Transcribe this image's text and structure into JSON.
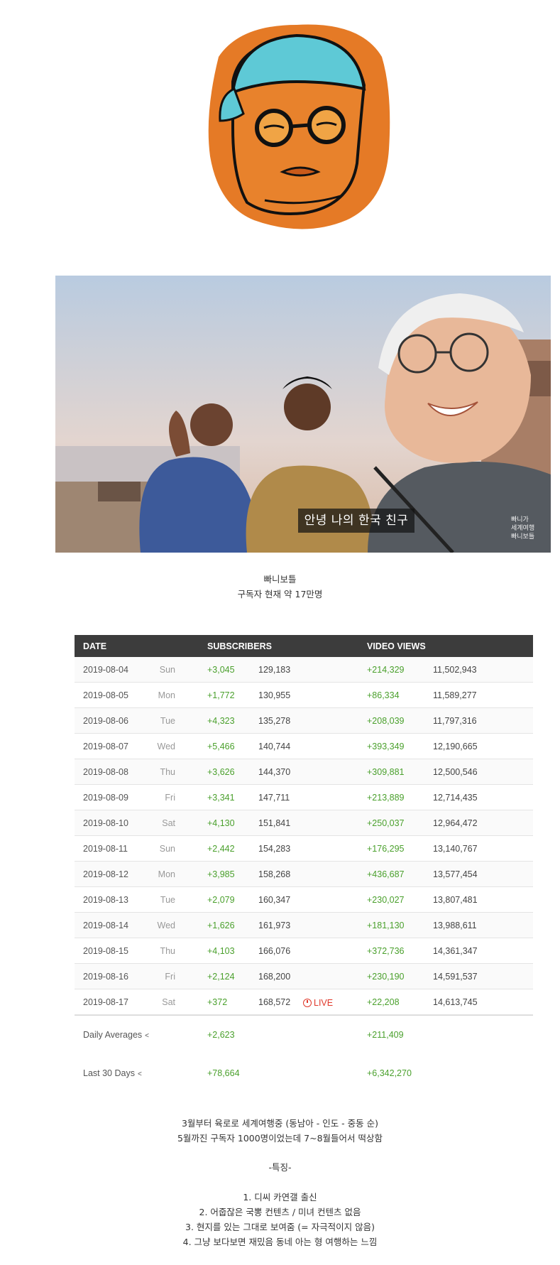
{
  "caption1": [
    "빠니보틀",
    "구독자 현재 약 17만명"
  ],
  "photo": {
    "subtitle": "안녕 나의 한국 친구",
    "watermark": [
      "빠니가",
      "세계여행",
      "빠니보틀"
    ]
  },
  "stats": {
    "headers": {
      "date": "DATE",
      "subscribers": "SUBSCRIBERS",
      "views": "VIDEO VIEWS"
    },
    "rows": [
      {
        "date": "2019-08-04",
        "day": "Sun",
        "sub_delta": "+3,045",
        "sub_total": "129,183",
        "view_delta": "+214,329",
        "view_total": "11,502,943",
        "live": ""
      },
      {
        "date": "2019-08-05",
        "day": "Mon",
        "sub_delta": "+1,772",
        "sub_total": "130,955",
        "view_delta": "+86,334",
        "view_total": "11,589,277",
        "live": ""
      },
      {
        "date": "2019-08-06",
        "day": "Tue",
        "sub_delta": "+4,323",
        "sub_total": "135,278",
        "view_delta": "+208,039",
        "view_total": "11,797,316",
        "live": ""
      },
      {
        "date": "2019-08-07",
        "day": "Wed",
        "sub_delta": "+5,466",
        "sub_total": "140,744",
        "view_delta": "+393,349",
        "view_total": "12,190,665",
        "live": ""
      },
      {
        "date": "2019-08-08",
        "day": "Thu",
        "sub_delta": "+3,626",
        "sub_total": "144,370",
        "view_delta": "+309,881",
        "view_total": "12,500,546",
        "live": ""
      },
      {
        "date": "2019-08-09",
        "day": "Fri",
        "sub_delta": "+3,341",
        "sub_total": "147,711",
        "view_delta": "+213,889",
        "view_total": "12,714,435",
        "live": ""
      },
      {
        "date": "2019-08-10",
        "day": "Sat",
        "sub_delta": "+4,130",
        "sub_total": "151,841",
        "view_delta": "+250,037",
        "view_total": "12,964,472",
        "live": ""
      },
      {
        "date": "2019-08-11",
        "day": "Sun",
        "sub_delta": "+2,442",
        "sub_total": "154,283",
        "view_delta": "+176,295",
        "view_total": "13,140,767",
        "live": ""
      },
      {
        "date": "2019-08-12",
        "day": "Mon",
        "sub_delta": "+3,985",
        "sub_total": "158,268",
        "view_delta": "+436,687",
        "view_total": "13,577,454",
        "live": ""
      },
      {
        "date": "2019-08-13",
        "day": "Tue",
        "sub_delta": "+2,079",
        "sub_total": "160,347",
        "view_delta": "+230,027",
        "view_total": "13,807,481",
        "live": ""
      },
      {
        "date": "2019-08-14",
        "day": "Wed",
        "sub_delta": "+1,626",
        "sub_total": "161,973",
        "view_delta": "+181,130",
        "view_total": "13,988,611",
        "live": ""
      },
      {
        "date": "2019-08-15",
        "day": "Thu",
        "sub_delta": "+4,103",
        "sub_total": "166,076",
        "view_delta": "+372,736",
        "view_total": "14,361,347",
        "live": ""
      },
      {
        "date": "2019-08-16",
        "day": "Fri",
        "sub_delta": "+2,124",
        "sub_total": "168,200",
        "view_delta": "+230,190",
        "view_total": "14,591,537",
        "live": ""
      },
      {
        "date": "2019-08-17",
        "day": "Sat",
        "sub_delta": "+372",
        "sub_total": "168,572",
        "view_delta": "+22,208",
        "view_total": "14,613,745",
        "live": "LIVE"
      }
    ],
    "summary": [
      {
        "label": "Daily Averages",
        "sub": "+2,623",
        "views": "+211,409"
      },
      {
        "label": "Last 30 Days",
        "sub": "+78,664",
        "views": "+6,342,270"
      }
    ]
  },
  "caption2": [
    "3월부터 육로로 세계여행중 (동남아 - 인도 - 중동 순)",
    "5월까진 구독자 1000명이었는데 7~8월들어서 떡상함"
  ],
  "features_title": "-특징-",
  "features": [
    "1. 디씨 카연갤 출신",
    "2. 어줍잖은 국뽕 컨텐츠 / 미녀 컨텐츠 없음",
    "3. 현지를 있는 그대로 보여줌 (= 자극적이지 않음)",
    "4. 그냥 보다보면 재밌음 동네 아는 형 여행하는 느낌"
  ],
  "colors": {
    "avatar_orange": "#e57a26",
    "cap_teal": "#5ec9d6",
    "header_bg": "#3c3c3c",
    "positive": "#4aa02c",
    "live": "#e0392b"
  }
}
